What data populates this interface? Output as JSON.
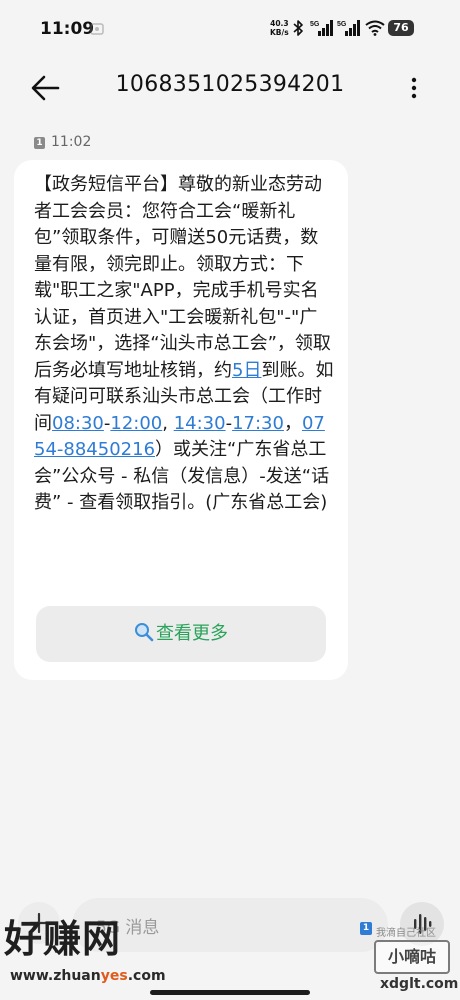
{
  "status_bar": {
    "time": "11:09",
    "net_speed_value": "40.3",
    "net_speed_unit": "KB/s",
    "signal1_label": "5G",
    "signal2_label": "5G",
    "battery": "76"
  },
  "header": {
    "title": "1068351025394201"
  },
  "message_time": {
    "sim": "1",
    "time": "11:02"
  },
  "message": {
    "segments": [
      "【政务短信平台】尊敬的新业态劳动者工会会员：您符合工会“暖新礼包”领取条件，可赠送50元话费，数量有限，领完即止。领取方式：下载\"职工之家\"APP，完成手机号实名认证，首页进入\"工会暖新礼包\"-\"广东会场\"，选择“汕头市总工会”，领取后务必填写地址核销，约",
      "5日",
      "到账。如有疑问可联系汕头市总工会（工作时间",
      "08:30",
      "-",
      "12:00",
      ", ",
      "14:30",
      "-",
      "17:30",
      "，",
      "0754-88450216",
      "）或关注“广东省总工会”公众号 - 私信（发信息）-发送“话费” - 查看领取指引。(广东省总工会)"
    ]
  },
  "view_more": {
    "label": "查看更多"
  },
  "composer": {
    "placeholder": "5G 消息",
    "sim": "1"
  },
  "watermark": {
    "main": "好赚网",
    "url_prefix": "www.zhuan",
    "url_highlight": "yes",
    "url_suffix": ".com",
    "small": "我滴自己社区",
    "badge": "小嘀咕",
    "site": "xdglt.com"
  },
  "colors": {
    "link": "#2f7cd6",
    "view_more_text": "#2aa35a",
    "bubble_bg": "#ffffff",
    "page_bg": "#f4f4f4"
  },
  "icons": {
    "back": "arrow-left-icon",
    "more": "more-vertical-icon",
    "search": "magnifier-icon",
    "add": "plus-icon",
    "voice": "voice-wave-icon"
  }
}
